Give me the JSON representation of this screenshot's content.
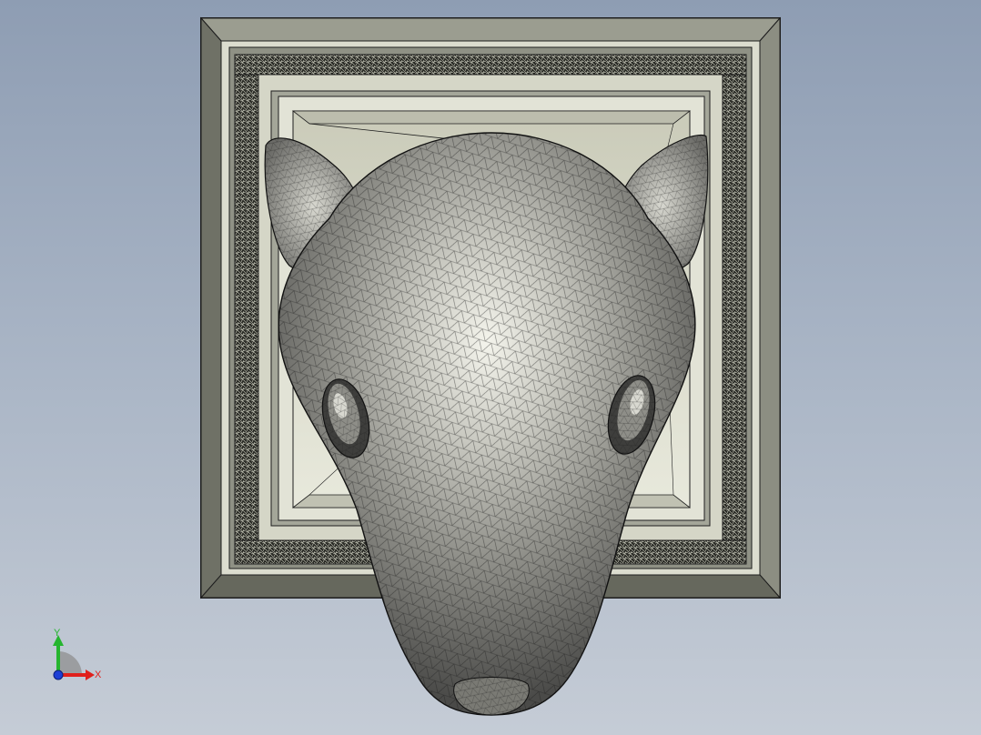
{
  "viewport": {
    "background_top": "#8e9db3",
    "background_bottom": "#c5ccd6"
  },
  "model": {
    "name_icon": "mouse-head-relief-icon",
    "frame_color": "#8a8c80",
    "frame_light": "#d9dacb",
    "panel_color": "#cfd0bf",
    "mesh_color": "#1c1c1c",
    "head_light": "#f4f4ec",
    "head_mid": "#9a9a94",
    "head_dark": "#4a4a48"
  },
  "triad": {
    "x_label": "X",
    "y_label": "Y",
    "x_color": "#e0201c",
    "y_color": "#25b52f",
    "origin_color": "#1d3fd6"
  }
}
